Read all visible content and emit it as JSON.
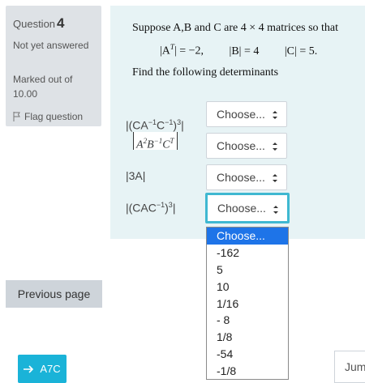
{
  "info": {
    "question_label": "Question",
    "question_number": "4",
    "state": "Not yet answered",
    "grade": "Marked out of 10.00",
    "flag_label": "Flag question"
  },
  "question": {
    "line1": "Suppose A,B and C are 4 × 4 matrices so that",
    "det_at": "|A",
    "det_at_sup": "T",
    "det_at_rest": "| = −2,",
    "det_b": "|B| = 4",
    "det_c": "|C| = 5.",
    "line3": "Find the following determinants"
  },
  "rows": [
    {
      "label_a": "|(CA",
      "sup1": "−1",
      "label_b": "C",
      "sup2": "−1",
      "label_c": ")",
      "sup3": "3",
      "label_d": "|",
      "select": "Choose..."
    },
    {
      "math_a": "A",
      "math_sup_a": "2",
      "math_b": "B",
      "math_sup_b": "−1",
      "math_c": "C",
      "math_sup_c": "T",
      "select": "Choose..."
    },
    {
      "label": "|3A|",
      "select": "Choose..."
    },
    {
      "label_a": "|(CAC",
      "sup1": "−1",
      "label_b": ")",
      "sup2": "3",
      "label_c": "|",
      "select": "Choose..."
    }
  ],
  "dropdown_options": [
    "Choose...",
    "-162",
    "5",
    "10",
    "1/16",
    "- 8",
    "1/8",
    "-54",
    "-1/8"
  ],
  "nav": {
    "previous_page": "Previous page",
    "atc_label": "A7C",
    "jump_label": "Jum"
  },
  "colors": {
    "accent": "#3fb8d1",
    "selected_option": "#1e74e8",
    "atc_button": "#1ab3d8"
  }
}
